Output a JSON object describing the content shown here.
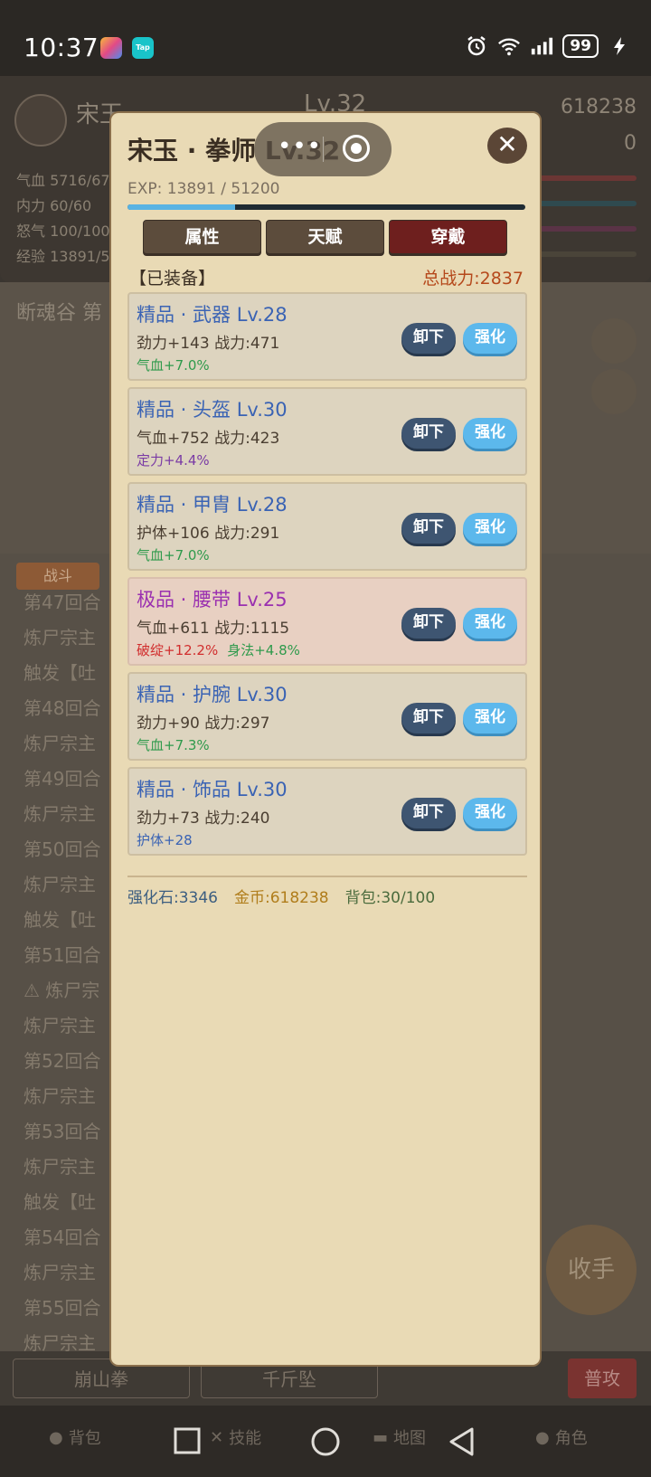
{
  "status_bar": {
    "time": "10:37",
    "battery": "99",
    "badge2": "Tap"
  },
  "background": {
    "name": "宋玉",
    "level": "Lv.32",
    "gold": "618238",
    "gem": "0",
    "stats": [
      "气血 5716/67",
      "内力 60/60",
      "怒气 100/100",
      "经验 13891/5"
    ],
    "location": "断魂谷 第",
    "tab": "战斗",
    "log_lines": [
      "第47回合",
      "炼尸宗主",
      "触发【吐",
      "第48回合",
      "炼尸宗主",
      "第49回合",
      "炼尸宗主",
      "第50回合",
      "炼尸宗主",
      "触发【吐",
      "第51回合",
      "⚠ 炼尸宗",
      "炼尸宗主",
      "第52回合",
      "炼尸宗主",
      "第53回合",
      "炼尸宗主",
      "触发【吐",
      "第54回合",
      "炼尸宗主",
      "第55回合",
      "炼尸宗主"
    ],
    "skill1": "崩山拳",
    "skill2": "千斤坠",
    "attack": "普攻",
    "retreat": "收手"
  },
  "nav": {
    "bag": "背包",
    "skill": "技能",
    "map": "地图",
    "role": "角色"
  },
  "modal": {
    "title": "宋玉 · 拳师 Lv.32",
    "exp_text": "EXP: 13891 / 51200",
    "exp_fraction": 0.27,
    "tabs": [
      "属性",
      "天赋",
      "穿戴"
    ],
    "section": "【已装备】",
    "total_power": "总战力:2837",
    "unload_label": "卸下",
    "enhance_label": "强化",
    "items": [
      {
        "name": "精品 · 武器 Lv.28",
        "stat": "劲力+143 战力:471",
        "bonuses": [
          {
            "text": "气血+7.0%",
            "color": "green"
          }
        ],
        "rarity": "blue"
      },
      {
        "name": "精品 · 头盔 Lv.30",
        "stat": "气血+752 战力:423",
        "bonuses": [
          {
            "text": "定力+4.4%",
            "color": "purple"
          }
        ],
        "rarity": "blue"
      },
      {
        "name": "精品 · 甲胄 Lv.28",
        "stat": "护体+106 战力:291",
        "bonuses": [
          {
            "text": "气血+7.0%",
            "color": "green"
          }
        ],
        "rarity": "blue"
      },
      {
        "name": "极品 · 腰带 Lv.25",
        "stat": "气血+611 战力:1115",
        "bonuses": [
          {
            "text": "破绽+12.2%",
            "color": "red"
          },
          {
            "text": "身法+4.8%",
            "color": "green"
          }
        ],
        "rarity": "purple"
      },
      {
        "name": "精品 · 护腕 Lv.30",
        "stat": "劲力+90 战力:297",
        "bonuses": [
          {
            "text": "气血+7.3%",
            "color": "green"
          }
        ],
        "rarity": "blue"
      },
      {
        "name": "精品 · 饰品 Lv.30",
        "stat": "劲力+73 战力:240",
        "bonuses": [
          {
            "text": "护体+28",
            "color": "blue"
          }
        ],
        "rarity": "blue"
      }
    ],
    "footer": {
      "stone": "强化石:3346",
      "gold": "金币:618238",
      "bag": "背包:30/100"
    }
  }
}
